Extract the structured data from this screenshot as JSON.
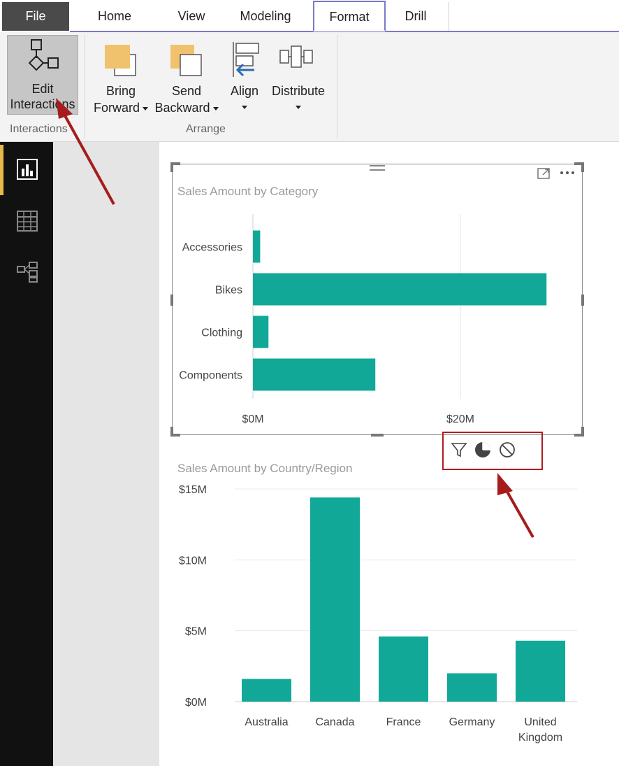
{
  "tabs": [
    {
      "label": "File"
    },
    {
      "label": "Home"
    },
    {
      "label": "View"
    },
    {
      "label": "Modeling"
    },
    {
      "label": "Format"
    },
    {
      "label": "Drill"
    }
  ],
  "ribbon": {
    "interactions_group": {
      "label": "Interactions",
      "edit_interactions": {
        "line1": "Edit",
        "line2": "Interactions"
      }
    },
    "arrange_group": {
      "label": "Arrange",
      "bring_forward": {
        "line1": "Bring",
        "line2": "Forward"
      },
      "send_backward": {
        "line1": "Send",
        "line2": "Backward"
      },
      "align": {
        "label": "Align"
      },
      "distribute": {
        "label": "Distribute"
      }
    }
  },
  "colors": {
    "bar": "#12a898",
    "annotation": "#b11d22",
    "format_tab_border": "#7a79c9",
    "nav_active": "#e8b84a"
  },
  "visual_icons": [
    "focus-mode-icon",
    "more-options-icon",
    "drag-handle-icon"
  ],
  "interaction_icons": [
    "filter-icon",
    "highlight-icon",
    "none-icon"
  ],
  "chart_data": [
    {
      "type": "bar",
      "orientation": "horizontal",
      "title": "Sales Amount by Category",
      "categories": [
        "Accessories",
        "Bikes",
        "Clothing",
        "Components"
      ],
      "values": [
        0.7,
        28.3,
        1.5,
        11.8
      ],
      "unit": "M",
      "x_ticks": [
        "$0M",
        "$20M"
      ],
      "xlim": [
        0,
        20
      ],
      "gridlines": true
    },
    {
      "type": "bar",
      "orientation": "vertical",
      "title": "Sales Amount by Country/Region",
      "categories": [
        "Australia",
        "Canada",
        "France",
        "Germany",
        "United Kingdom"
      ],
      "values": [
        1.6,
        14.4,
        4.6,
        2.0,
        4.3
      ],
      "unit": "M",
      "y_ticks": [
        "$0M",
        "$5M",
        "$10M",
        "$15M"
      ],
      "ylim": [
        0,
        15
      ],
      "gridlines": true
    }
  ]
}
